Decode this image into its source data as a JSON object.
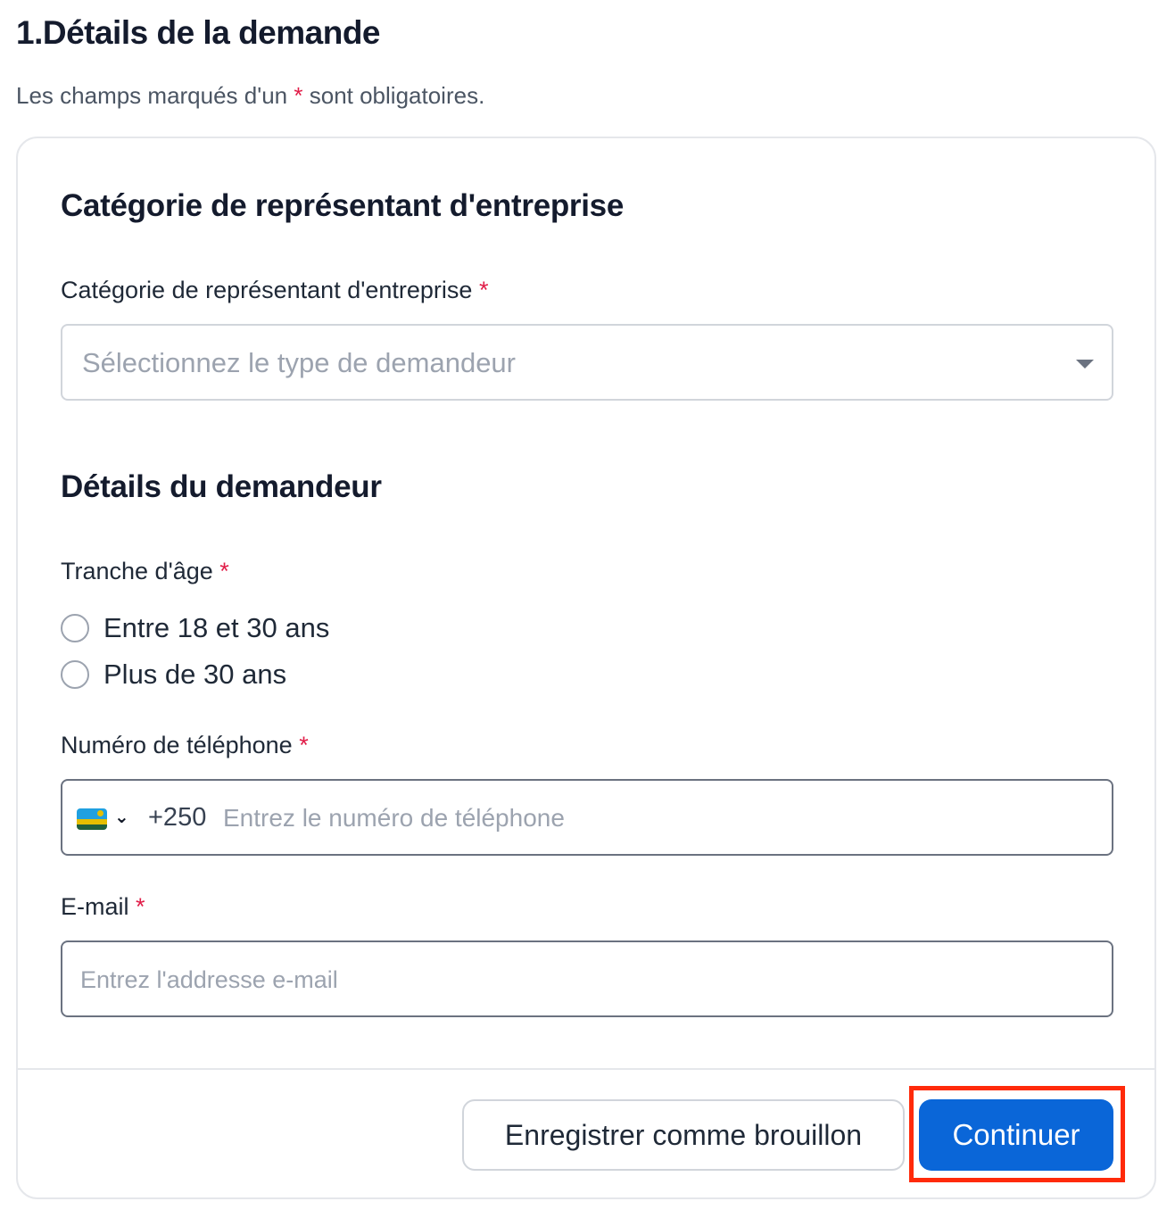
{
  "page": {
    "title": "1.Détails de la demande",
    "required_note_prefix": "Les champs marqués d'un",
    "required_star": "*",
    "required_note_suffix": "sont obligatoires."
  },
  "section_category": {
    "title": "Catégorie de représentant d'entreprise",
    "field_label": "Catégorie de représentant d'entreprise",
    "select_placeholder": "Sélectionnez le type de demandeur"
  },
  "section_applicant": {
    "title": "Détails du demandeur",
    "age_label": "Tranche d'âge",
    "age_options": [
      {
        "label": "Entre 18 et 30 ans",
        "selected": false
      },
      {
        "label": "Plus de 30 ans",
        "selected": false
      }
    ],
    "phone_label": "Numéro de téléphone",
    "phone_country_flag": "rwanda-flag-icon",
    "phone_dial_code": "+250",
    "phone_placeholder": "Entrez le numéro de téléphone",
    "email_label": "E-mail",
    "email_placeholder": "Entrez l'addresse e-mail"
  },
  "footer": {
    "draft_button": "Enregistrer comme brouillon",
    "continue_button": "Continuer"
  },
  "colors": {
    "primary": "#0a66d8",
    "required": "#e11d48",
    "highlight": "#ff2a0a"
  }
}
